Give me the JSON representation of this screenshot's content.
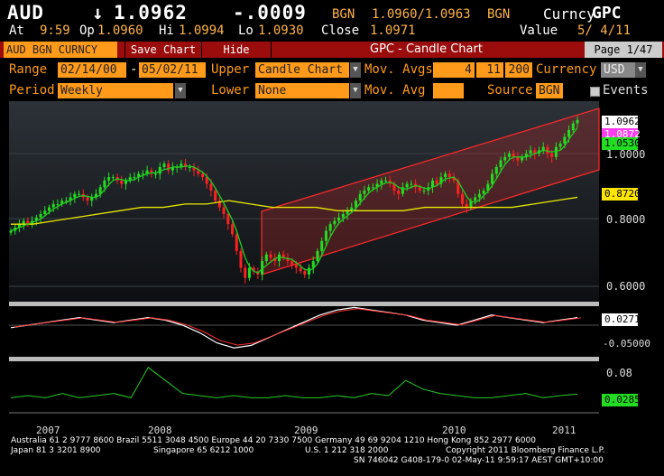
{
  "header": {
    "ticker": "AUD",
    "arrow": "↓",
    "price": "1.0962",
    "change": "-.0009",
    "source1": "BGN",
    "bidask": "1.0960/1.0963",
    "source2": "BGN",
    "curncy": "Curncy",
    "func": "GPC",
    "at_label": "At",
    "time": "9:59",
    "op_label": "Op",
    "op": "1.0960",
    "hi_label": "Hi",
    "hi": "1.0994",
    "lo_label": "Lo",
    "lo": "1.0930",
    "close_label": "Close",
    "close": "1.0971",
    "value_label": "Value",
    "value_date": "5/ 4/11"
  },
  "toolbar": {
    "security": "AUD BGN CURNCY",
    "save_chart": "Save Chart",
    "hide": "Hide",
    "title": "GPC - Candle Chart",
    "page": "Page 1/47"
  },
  "controls": {
    "range_label": "Range",
    "range_start": "02/14/00",
    "range_sep": "-",
    "range_end": "05/02/11",
    "upper_label": "Upper",
    "upper_value": "Candle Chart",
    "movavgs_label": "Mov. Avgs",
    "ma1": "4",
    "ma2": "11",
    "ma3": "200",
    "currency_label": "Currency",
    "currency_value": "USD",
    "period_label": "Period",
    "period_value": "Weekly",
    "lower_label": "Lower",
    "lower_value": "None",
    "movavg_label": "Mov. Avg",
    "movavg_value": "",
    "source_label": "Source",
    "source_value": "BGN",
    "events_label": "Events"
  },
  "price_labels": {
    "last": "1.0962",
    "ma_a": "1.0872",
    "ma_b": "1.0530",
    "ma200": "0.8720",
    "ticks": [
      "1.0000",
      "0.8000",
      "0.6000"
    ]
  },
  "osc1": {
    "value": "0.0271",
    "tick": "-0.05000"
  },
  "osc2": {
    "value": "0.0285",
    "tick": "0.08"
  },
  "x_axis": [
    "2007",
    "2008",
    "2009",
    "2010",
    "2011"
  ],
  "footer": {
    "line1": "Australia 61 2 9777 8600 Brazil 5511 3048 4500 Europe 44 20 7330 7500 Germany 49 69 9204 1210 Hong Kong 852 2977 6000",
    "line2a": "Japan 81 3 3201 8900",
    "line2b": "Singapore 65 6212 1000",
    "line2c": "U.S. 1 212 318 2000",
    "line2d": "Copyright 2011 Bloomberg Finance L.P.",
    "line3": "SN 746042 G408-179-0 02-May-11  9:59:17 AEST GMT+10:00"
  },
  "colors": {
    "accent": "#ff9a1a",
    "bull": "#22dd22",
    "bear": "#ff2020",
    "channel": "#ff2a2a",
    "ma200": "#e8e800",
    "ma_fast": "#ffffff",
    "ma_slow": "#22cc22"
  },
  "chart_data": {
    "type": "candlestick",
    "x_ticks": [
      "2007",
      "2008",
      "2009",
      "2010",
      "2011"
    ],
    "ylim": [
      0.57,
      1.14
    ],
    "close_series": [
      0.77,
      0.78,
      0.79,
      0.8,
      0.79,
      0.8,
      0.81,
      0.82,
      0.83,
      0.84,
      0.85,
      0.85,
      0.86,
      0.86,
      0.87,
      0.88,
      0.88,
      0.87,
      0.86,
      0.87,
      0.88,
      0.9,
      0.92,
      0.93,
      0.93,
      0.92,
      0.91,
      0.92,
      0.93,
      0.93,
      0.94,
      0.94,
      0.95,
      0.94,
      0.94,
      0.96,
      0.97,
      0.95,
      0.96,
      0.96,
      0.97,
      0.96,
      0.96,
      0.95,
      0.94,
      0.93,
      0.91,
      0.89,
      0.86,
      0.84,
      0.82,
      0.79,
      0.76,
      0.71,
      0.66,
      0.63,
      0.66,
      0.65,
      0.64,
      0.68,
      0.7,
      0.69,
      0.68,
      0.7,
      0.69,
      0.68,
      0.67,
      0.66,
      0.65,
      0.64,
      0.66,
      0.68,
      0.71,
      0.74,
      0.77,
      0.79,
      0.8,
      0.81,
      0.82,
      0.83,
      0.84,
      0.86,
      0.88,
      0.89,
      0.9,
      0.9,
      0.91,
      0.92,
      0.92,
      0.91,
      0.89,
      0.88,
      0.9,
      0.91,
      0.91,
      0.9,
      0.89,
      0.89,
      0.9,
      0.92,
      0.91,
      0.93,
      0.94,
      0.93,
      0.92,
      0.88,
      0.85,
      0.84,
      0.86,
      0.87,
      0.88,
      0.89,
      0.91,
      0.94,
      0.96,
      0.98,
      0.99,
      1.0,
      0.99,
      0.98,
      0.99,
      1.0,
      1.01,
      1.0,
      1.01,
      1.02,
      1.0,
      0.99,
      1.02,
      1.03,
      1.05,
      1.07,
      1.09,
      1.1
    ],
    "ma200_series": [
      0.79,
      0.79,
      0.8,
      0.81,
      0.82,
      0.83,
      0.84,
      0.84,
      0.85,
      0.85,
      0.86,
      0.85,
      0.84,
      0.84,
      0.84,
      0.83,
      0.83,
      0.83,
      0.83,
      0.84,
      0.84,
      0.84,
      0.84,
      0.84,
      0.85,
      0.86,
      0.87
    ],
    "osc1_series": [
      -0.01,
      0.0,
      0.01,
      0.02,
      0.03,
      0.02,
      0.01,
      0.02,
      0.03,
      0.02,
      0.0,
      -0.03,
      -0.07,
      -0.09,
      -0.08,
      -0.05,
      -0.02,
      0.01,
      0.04,
      0.06,
      0.07,
      0.06,
      0.05,
      0.04,
      0.02,
      0.01,
      0.0,
      0.02,
      0.04,
      0.03,
      0.02,
      0.01,
      0.02,
      0.03
    ],
    "osc2_series": [
      0.02,
      0.025,
      0.02,
      0.03,
      0.02,
      0.025,
      0.03,
      0.02,
      0.09,
      0.06,
      0.03,
      0.025,
      0.02,
      0.025,
      0.02,
      0.02,
      0.025,
      0.02,
      0.02,
      0.025,
      0.02,
      0.03,
      0.025,
      0.06,
      0.04,
      0.03,
      0.025,
      0.02,
      0.02,
      0.025,
      0.03,
      0.02,
      0.025,
      0.0285
    ]
  }
}
